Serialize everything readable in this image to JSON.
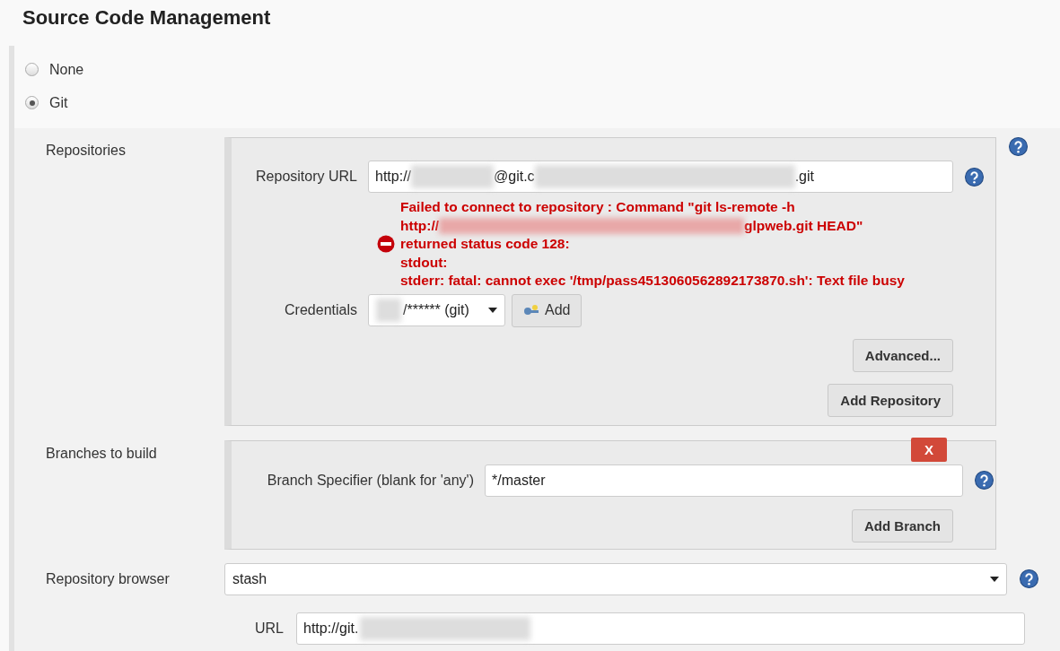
{
  "section_title": "Source Code Management",
  "scm_options": [
    {
      "label": "None",
      "selected": false
    },
    {
      "label": "Git",
      "selected": true
    }
  ],
  "repositories": {
    "label": "Repositories",
    "url": {
      "label": "Repository URL",
      "value_parts": [
        "http://",
        "@git.c",
        ".git"
      ]
    },
    "error": {
      "lines": [
        [
          "Failed to connect to repository : Command \"git ls-remote -h"
        ],
        [
          "http://",
          "glpweb.git HEAD\""
        ],
        [
          "returned status code 128:"
        ],
        [
          "stdout:"
        ],
        [
          "stderr: fatal: cannot exec '/tmp/pass4513060562892173870.sh': Text file busy"
        ]
      ]
    },
    "credentials": {
      "label": "Credentials",
      "value": "/****** (git)",
      "add_button": "Add"
    },
    "buttons": [
      "Advanced...",
      "Add Repository"
    ]
  },
  "branches": {
    "label": "Branches to build",
    "delete_button": "X",
    "specifier_label": "Branch Specifier (blank for 'any')",
    "specifier_value": "*/master",
    "add_button": "Add Branch"
  },
  "repository_browser": {
    "label": "Repository browser",
    "value": "stash",
    "url_label": "URL",
    "url_value": "http://git."
  }
}
